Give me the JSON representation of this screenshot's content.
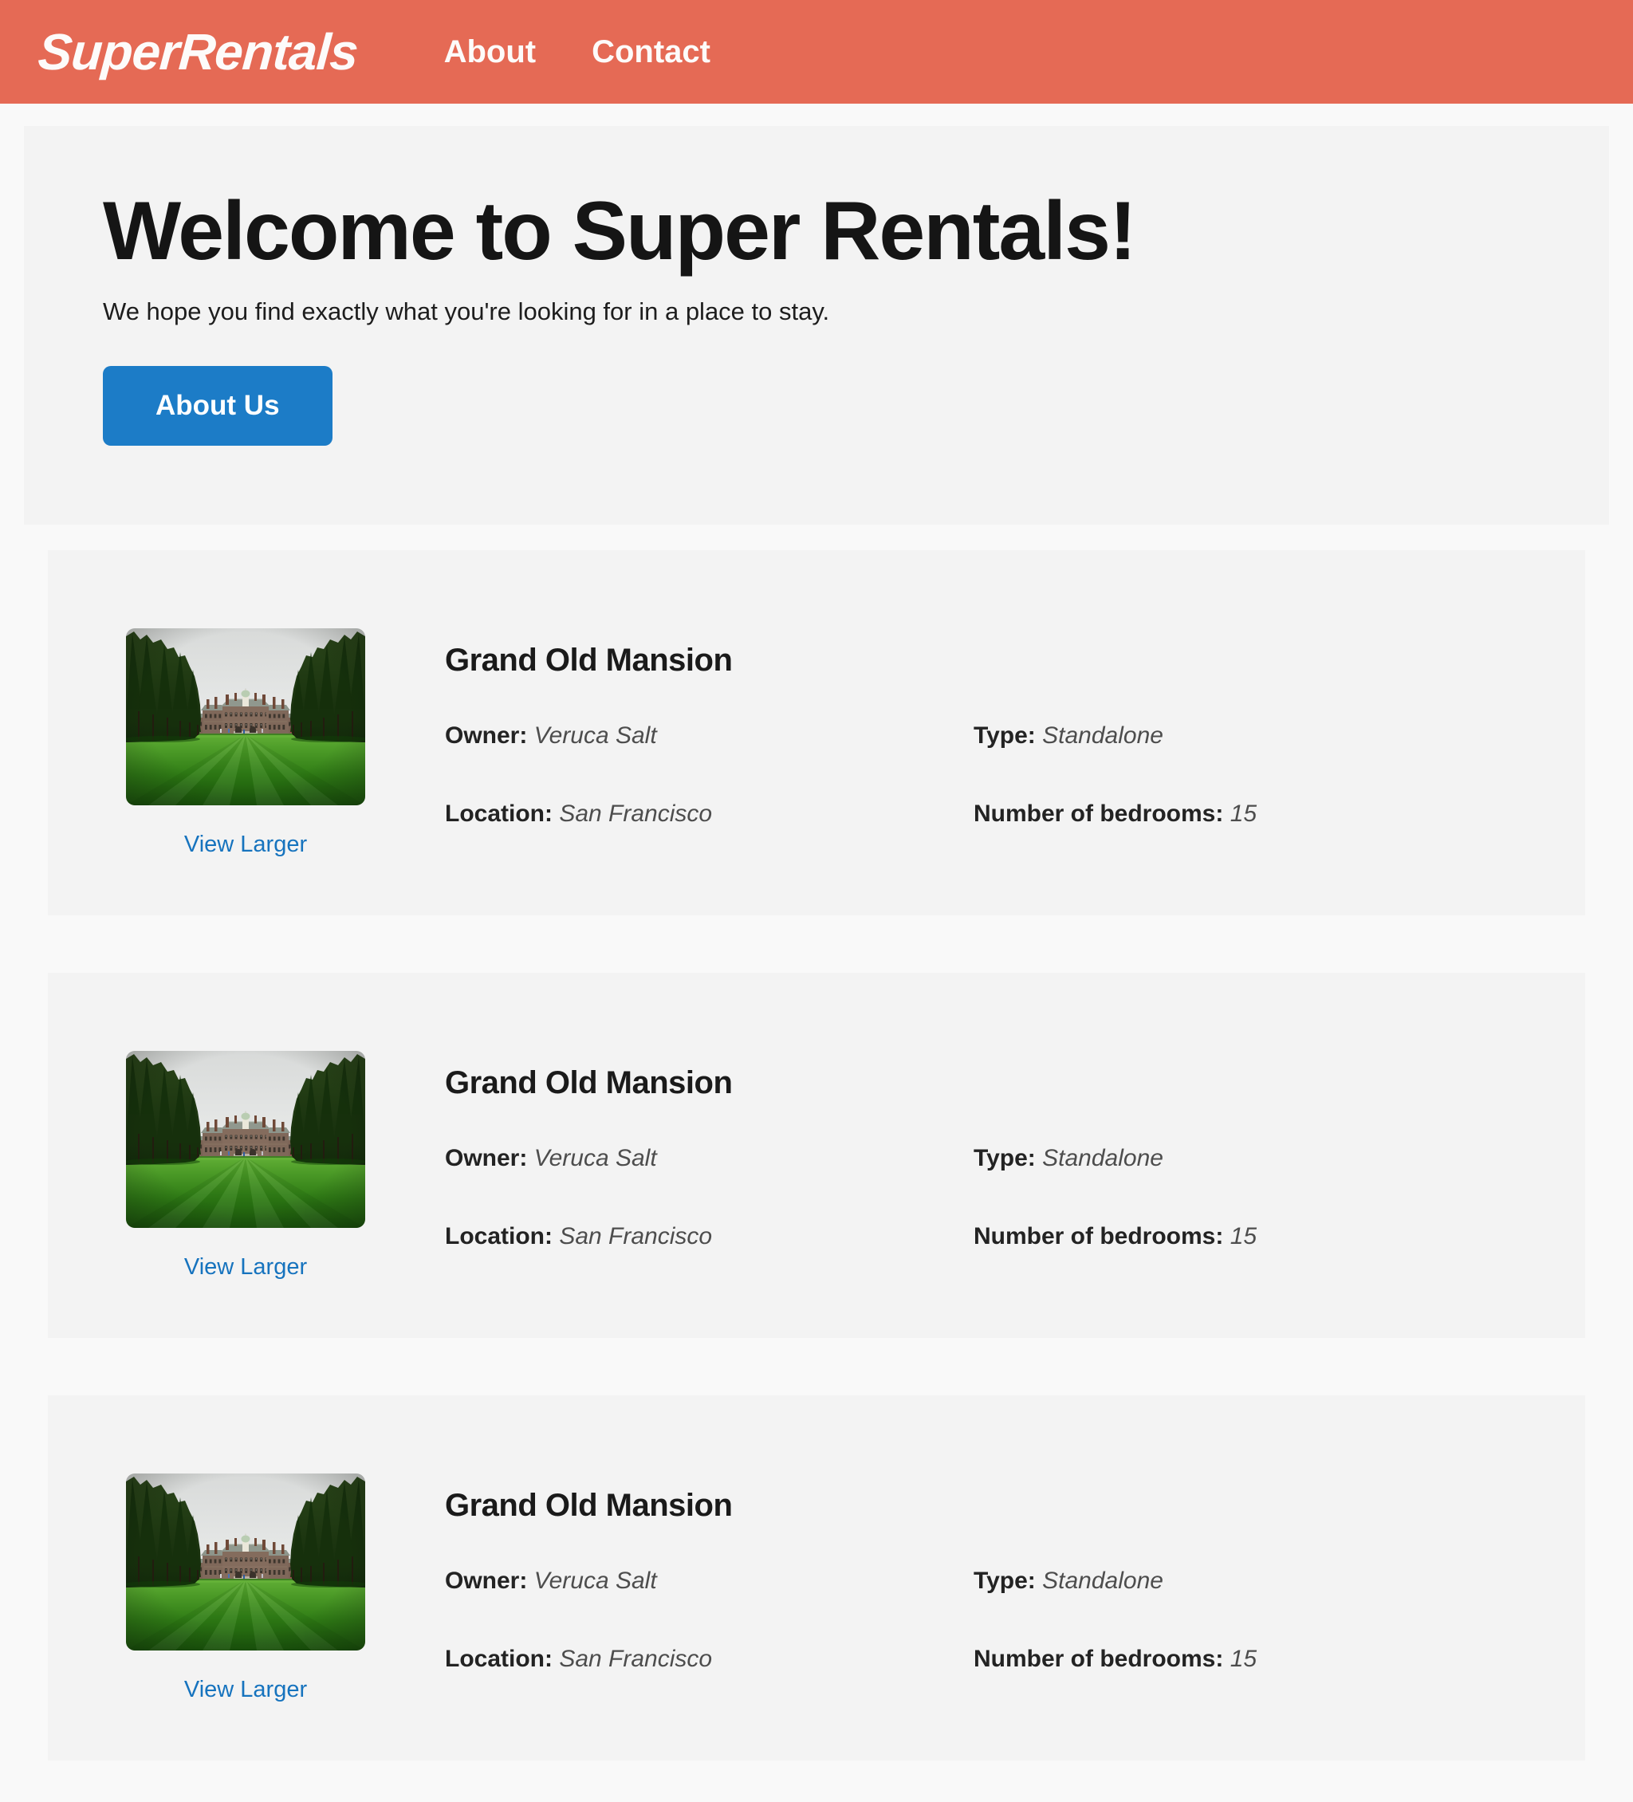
{
  "colors": {
    "navbar_coral": "#e56a55",
    "panel_gray": "#f3f3f3",
    "page_background": "#f9f9f9",
    "button_blue": "#1c7cc7",
    "link_blue": "#1673be"
  },
  "navbar": {
    "logo": "SuperRentals",
    "links": [
      {
        "label": "About"
      },
      {
        "label": "Contact"
      }
    ]
  },
  "jumbotron": {
    "title": "Welcome to Super Rentals!",
    "subtitle": "We hope you find exactly what you're looking for in a place to stay.",
    "cta_label": "About Us"
  },
  "rentals": [
    {
      "title": "Grand Old Mansion",
      "owner_label": "Owner:",
      "owner": "Veruca Salt",
      "type_label": "Type:",
      "type": "Standalone",
      "location_label": "Location:",
      "location": "San Francisco",
      "bedrooms_label": "Number of bedrooms:",
      "bedrooms": "15",
      "view_larger_label": "View Larger"
    },
    {
      "title": "Grand Old Mansion",
      "owner_label": "Owner:",
      "owner": "Veruca Salt",
      "type_label": "Type:",
      "type": "Standalone",
      "location_label": "Location:",
      "location": "San Francisco",
      "bedrooms_label": "Number of bedrooms:",
      "bedrooms": "15",
      "view_larger_label": "View Larger"
    },
    {
      "title": "Grand Old Mansion",
      "owner_label": "Owner:",
      "owner": "Veruca Salt",
      "type_label": "Type:",
      "type": "Standalone",
      "location_label": "Location:",
      "location": "San Francisco",
      "bedrooms_label": "Number of bedrooms:",
      "bedrooms": "15",
      "view_larger_label": "View Larger"
    }
  ]
}
